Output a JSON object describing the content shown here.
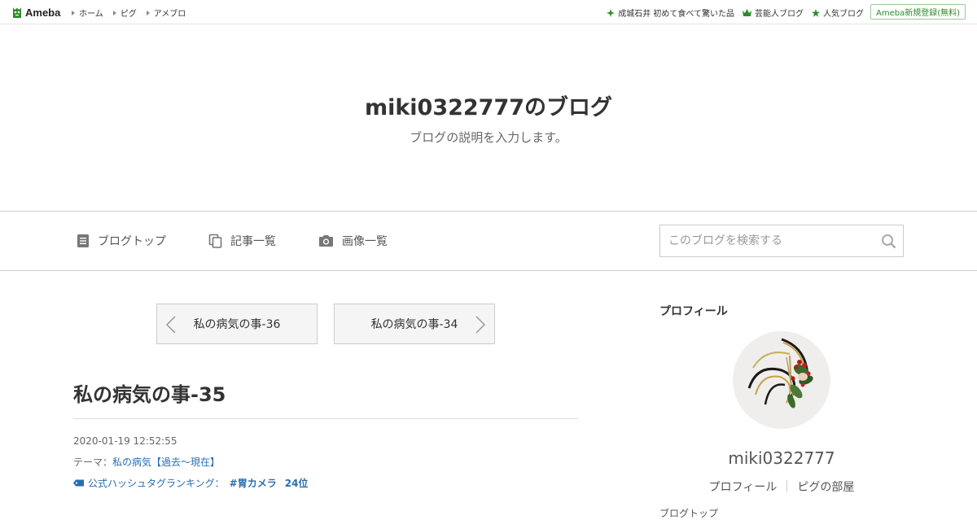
{
  "topbar": {
    "logo_text": "Ameba",
    "nav": [
      "ホーム",
      "ピグ",
      "アメブロ"
    ],
    "links": [
      {
        "icon": "sparkle-icon",
        "label": "成城石井 初めて食べて驚いた品"
      },
      {
        "icon": "crown-icon",
        "label": "芸能人ブログ"
      },
      {
        "icon": "star-icon",
        "label": "人気ブログ"
      }
    ],
    "register_label": "Ameba新規登録(無料)",
    "accent_color": "#2d8a2d"
  },
  "header": {
    "title": "miki0322777のブログ",
    "description": "ブログの説明を入力します。"
  },
  "navbar": {
    "items": [
      {
        "icon": "document-icon",
        "label": "ブログトップ"
      },
      {
        "icon": "copy-icon",
        "label": "記事一覧"
      },
      {
        "icon": "camera-icon",
        "label": "画像一覧"
      }
    ],
    "search_placeholder": "このブログを検索する"
  },
  "pager": {
    "prev_label": "私の病気の事-36",
    "next_label": "私の病気の事-34"
  },
  "article": {
    "title": "私の病気の事-35",
    "date": "2020-01-19 12:52:55",
    "theme_prefix": "テーマ：",
    "theme": "私の病気【過去～現在】",
    "hashtag_prefix": "公式ハッシュタグランキング：",
    "hashtag": "#胃カメラ",
    "rank": "24位",
    "link_color": "#2a6eb0"
  },
  "sidebar": {
    "heading": "プロフィール",
    "name": "miki0322777",
    "links": [
      "プロフィール",
      "ピグの部屋"
    ],
    "cut_text": "ブログトップ"
  }
}
